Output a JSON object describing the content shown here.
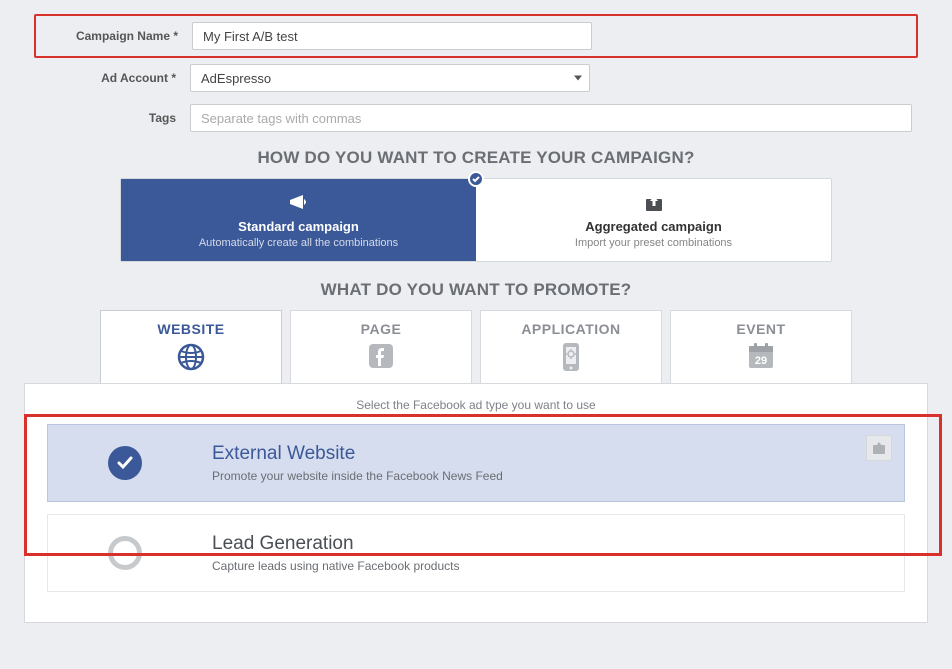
{
  "form": {
    "campaign_name_label": "Campaign Name *",
    "campaign_name_value": "My First A/B test",
    "ad_account_label": "Ad Account *",
    "ad_account_value": "AdEspresso",
    "tags_label": "Tags",
    "tags_placeholder": "Separate tags with commas"
  },
  "sections": {
    "create_heading": "HOW DO YOU WANT TO CREATE YOUR CAMPAIGN?",
    "promote_heading": "WHAT DO YOU WANT TO PROMOTE?",
    "ad_type_hint": "Select the Facebook ad type you want to use"
  },
  "campaign_types": {
    "standard": {
      "title": "Standard campaign",
      "sub": "Automatically create all the combinations"
    },
    "aggregated": {
      "title": "Aggregated campaign",
      "sub": "Import your preset combinations"
    }
  },
  "promote_tabs": {
    "website": "WEBSITE",
    "page": "PAGE",
    "application": "APPLICATION",
    "event": "EVENT",
    "event_day": "29"
  },
  "ad_types": {
    "external": {
      "title": "External Website",
      "desc": "Promote your website inside the Facebook News Feed"
    },
    "lead": {
      "title": "Lead Generation",
      "desc": "Capture leads using native Facebook products"
    }
  }
}
